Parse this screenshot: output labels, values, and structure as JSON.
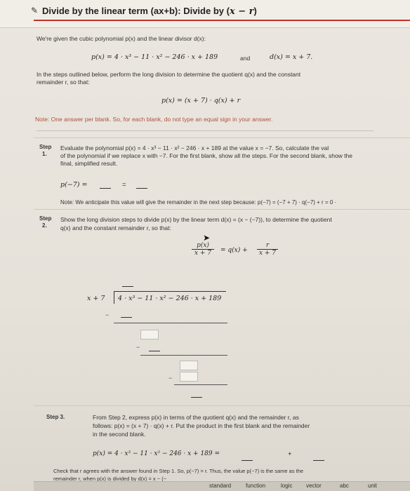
{
  "header": {
    "title_prefix": "Divide by the linear term (ax+b): Divide by (",
    "title_var": "x − r",
    "title_suffix": ")"
  },
  "intro": {
    "given_text": "We're given the cubic polynomial p(x) and the linear divisor d(x):",
    "p_eq": "p(x) = 4 · x³ − 11 · x² − 246 · x + 189",
    "and": "and",
    "d_eq": "d(x) = x + 7.",
    "steps_text_1": "In the steps outlined below, perform the long division to determine the quotient q(x) and the constant",
    "steps_text_2": "remainder r, so that:",
    "identity": "p(x) = (x + 7) · q(x) + r",
    "note": "Note: One answer per blank. So, for each blank, do not type an equal sign in your answer."
  },
  "step1": {
    "label_1": "Step",
    "label_2": "1.",
    "text_1": "Evaluate the polynomial p(x) = 4 · x³ − 11 · x² − 246 · x + 189 at the value x = −7. So, calculate the val",
    "text_2": "of the polynomial if we replace x with −7. For the first blank, show all the steps. For the second blank, show the",
    "text_3": "final, simplified result.",
    "eval_lhs": "p(−7) =",
    "eq_sign": "=",
    "note": "Note: We anticipate this value will give the remainder in the next step because: p(−7) = (−7 + 7) · q(−7) + r = 0 ·"
  },
  "step2": {
    "label_1": "Step",
    "label_2": "2.",
    "text_1": "Show the long division steps to divide p(x) by the linear term d(x) = (x − (−7)), to determine the quotient",
    "text_2": "q(x) and the constant remainder r, so that:",
    "frac_num": "p(x)",
    "frac_den": "x + 7",
    "eq_mid": "=  q(x) +",
    "frac2_num": "r",
    "frac2_den": "x + 7",
    "divisor": "x + 7",
    "dividend": "4 · x³ − 11 · x² − 246 · x + 189",
    "minus": "−"
  },
  "step3": {
    "label": "Step 3.",
    "text_1": "From Step 2, express p(x) in terms of the quotient q(x) and the remainder r, as",
    "text_2": "follows: p(x) = (x + 7) · q(x) + r. Put the product in the first blank and the remainder",
    "text_3": "in the second blank.",
    "expr": "p(x) = 4 · x³ − 11 · x² − 246 · x + 189  =",
    "plus": "+",
    "check_1": "Check that r agrees with the answer found in Step 1. So, p(−7) = r. Thus, the value p(−7) is the same as the",
    "check_2": "remainder r, when p(x) is divided by d(x) = x − (−"
  },
  "toolbar": {
    "items": [
      "standard",
      "function",
      "logic",
      "vector",
      "abc",
      "unit"
    ]
  }
}
